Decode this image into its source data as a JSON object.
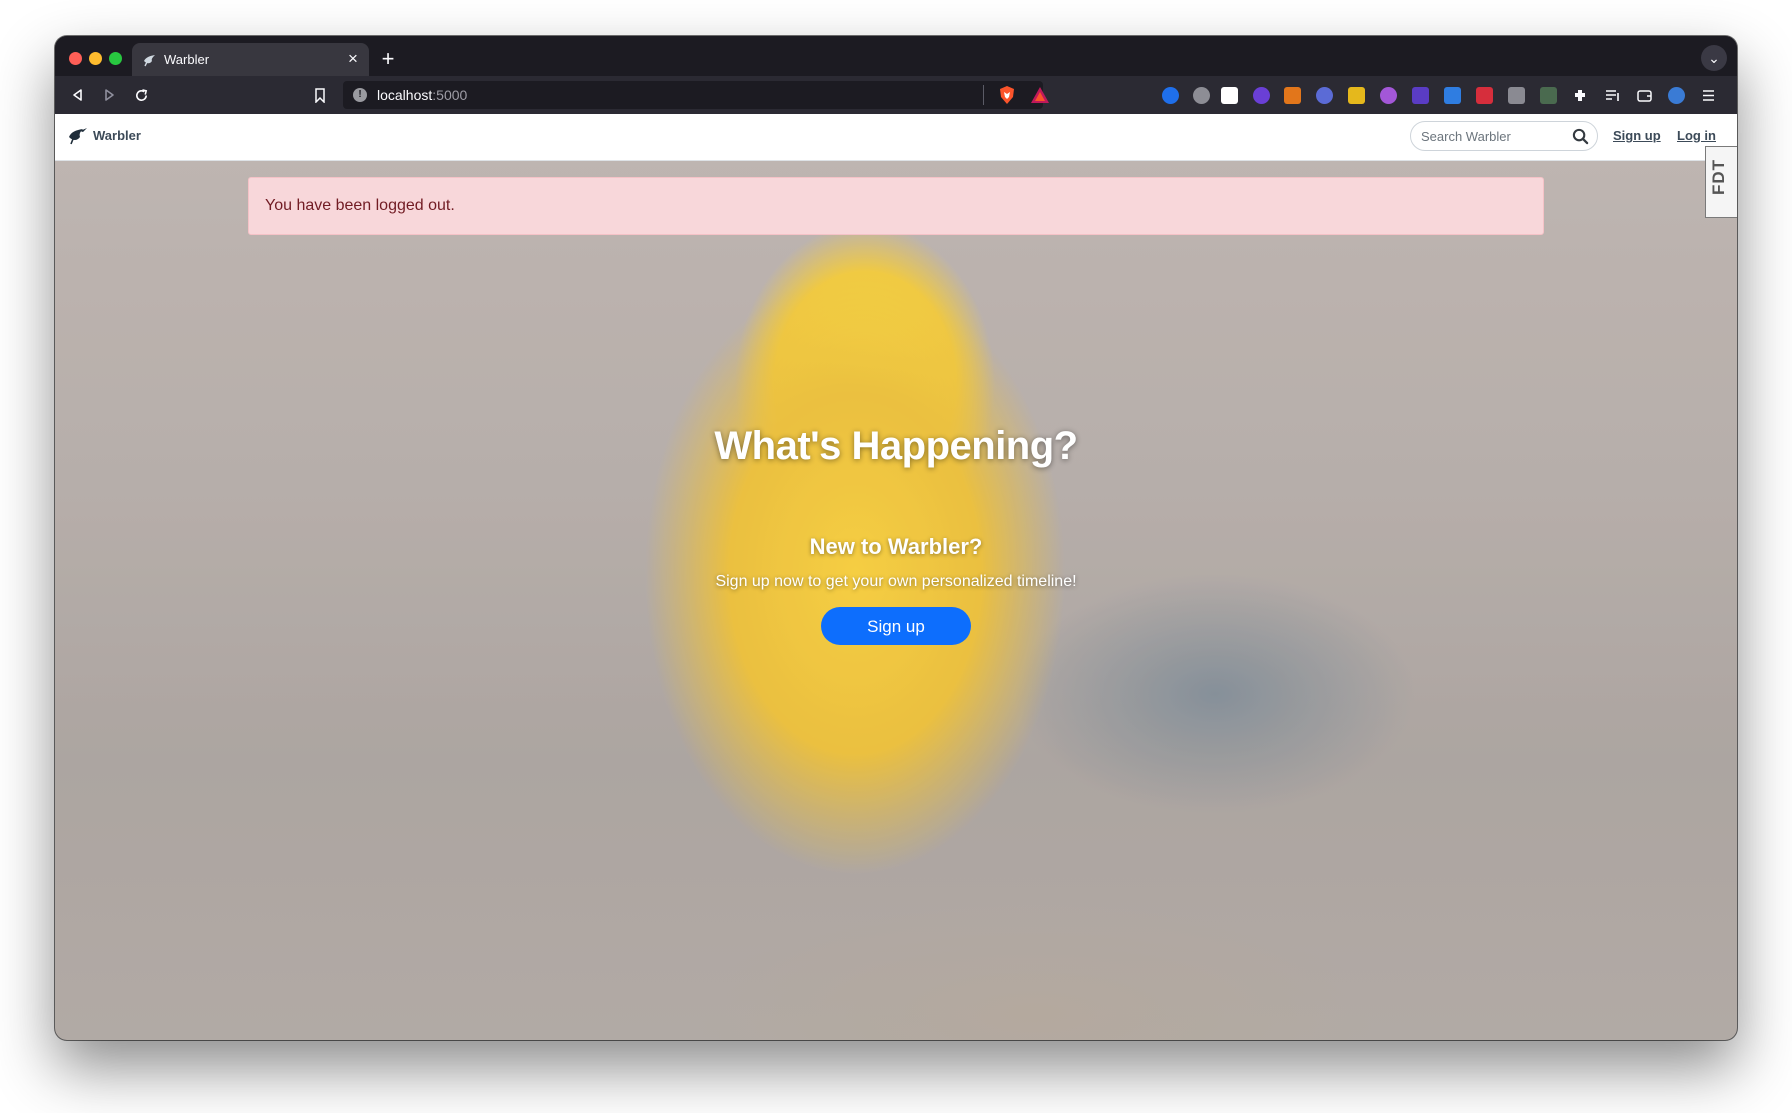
{
  "browser": {
    "tab_title": "Warbler",
    "tab_close_glyph": "×",
    "new_tab_glyph": "+",
    "tab_list_glyph": "⌄",
    "url_host": "localhost",
    "url_port": ":5000",
    "site_info_glyph": "!"
  },
  "navbar": {
    "brand": "Warbler",
    "search_placeholder": "Search Warbler",
    "signup_link": "Sign up",
    "login_link": "Log in",
    "devtools_tab": "FDT"
  },
  "alert": {
    "message": "You have been logged out."
  },
  "hero": {
    "title": "What's Happening?",
    "subtitle": "New to Warbler?",
    "text": "Sign up now to get your own personalized timeline!",
    "button": "Sign up"
  },
  "colors": {
    "alert_bg": "#f8d7da",
    "alert_text": "#721c24",
    "primary_button": "#0d6efd",
    "browser_chrome": "#2b2a33"
  },
  "icons": [
    "back-icon",
    "forward-icon",
    "reload-icon",
    "bookmark-icon",
    "brave-shield-icon",
    "brave-rewards-icon",
    "search-icon",
    "warbler-logo-icon",
    "extensions-icon"
  ]
}
